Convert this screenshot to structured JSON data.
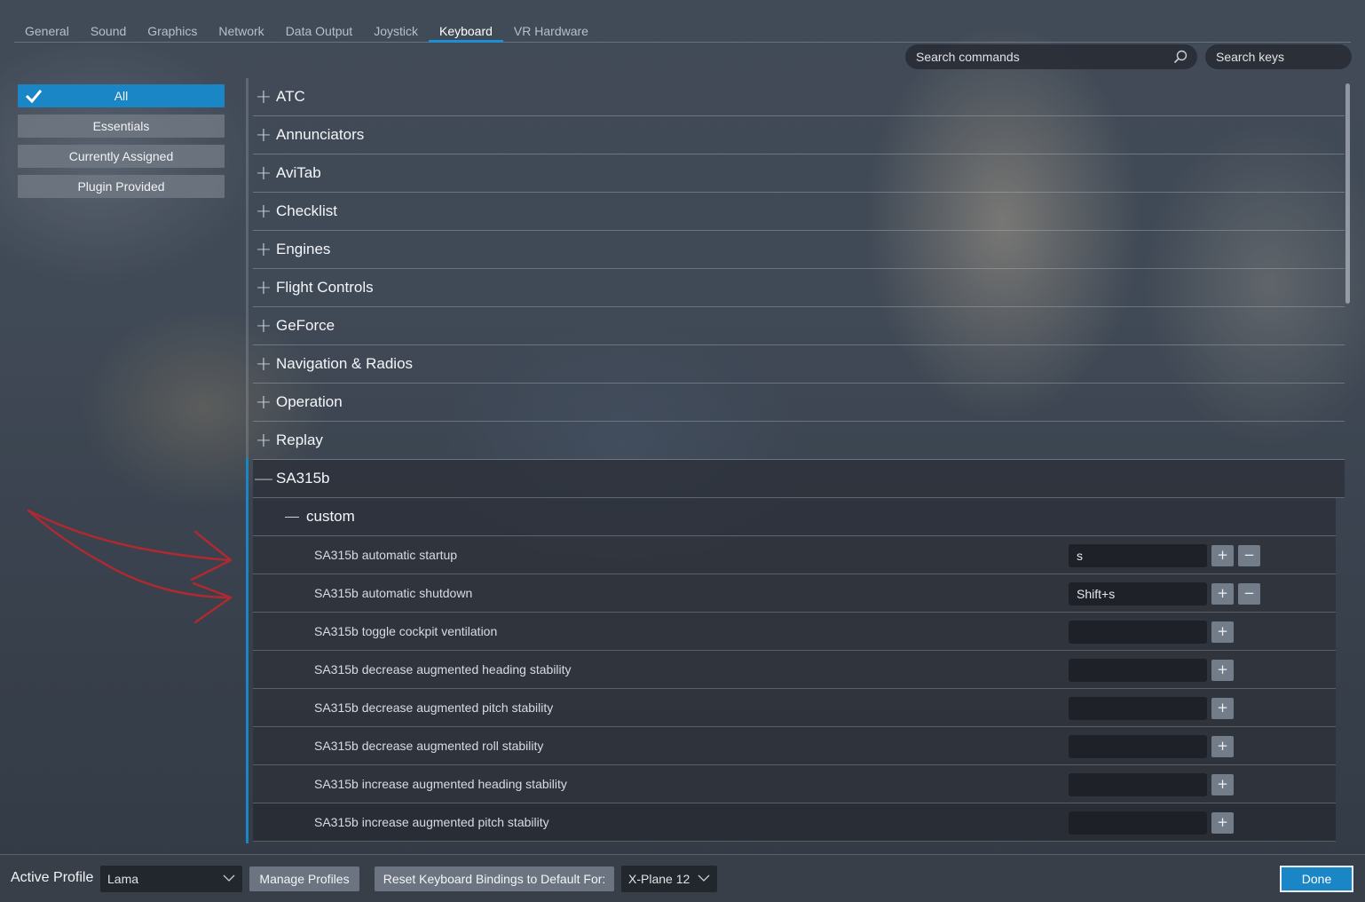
{
  "tabs": [
    {
      "label": "General"
    },
    {
      "label": "Sound"
    },
    {
      "label": "Graphics"
    },
    {
      "label": "Network"
    },
    {
      "label": "Data Output"
    },
    {
      "label": "Joystick"
    },
    {
      "label": "Keyboard",
      "active": true
    },
    {
      "label": "VR Hardware"
    }
  ],
  "search": {
    "commands_placeholder": "Search commands",
    "keys_placeholder": "Search keys"
  },
  "filters": [
    {
      "label": "All",
      "active": true
    },
    {
      "label": "Essentials"
    },
    {
      "label": "Currently Assigned"
    },
    {
      "label": "Plugin Provided"
    }
  ],
  "categories": [
    {
      "label": "ATC",
      "sign": "+"
    },
    {
      "label": "Annunciators",
      "sign": "+"
    },
    {
      "label": "AviTab",
      "sign": "+"
    },
    {
      "label": "Checklist",
      "sign": "+"
    },
    {
      "label": "Engines",
      "sign": "+"
    },
    {
      "label": "Flight Controls",
      "sign": "+"
    },
    {
      "label": "GeForce",
      "sign": "+"
    },
    {
      "label": "Navigation & Radios",
      "sign": "+"
    },
    {
      "label": "Operation",
      "sign": "+"
    },
    {
      "label": "Replay",
      "sign": "+"
    },
    {
      "label": "SA315b",
      "sign": "—"
    }
  ],
  "subcategory": {
    "label": "custom"
  },
  "commands": [
    {
      "label": "SA315b automatic startup",
      "key": "s"
    },
    {
      "label": "SA315b automatic shutdown",
      "key": "Shift+s"
    },
    {
      "label": "SA315b toggle cockpit ventilation",
      "key": ""
    },
    {
      "label": "SA315b decrease augmented heading stability",
      "key": ""
    },
    {
      "label": "SA315b decrease augmented pitch stability",
      "key": ""
    },
    {
      "label": "SA315b decrease augmented roll stability",
      "key": ""
    },
    {
      "label": "SA315b increase augmented heading stability",
      "key": ""
    },
    {
      "label": "SA315b increase augmented pitch stability",
      "key": ""
    }
  ],
  "buttons": {
    "add": "+",
    "remove": "−"
  },
  "bottom": {
    "active_profile_label": "Active Profile",
    "profile_value": "Lama",
    "manage_profiles": "Manage Profiles",
    "reset_label": "Reset Keyboard Bindings to Default For:",
    "reset_target": "X-Plane 12",
    "done": "Done"
  },
  "colors": {
    "accent": "#1b86c6",
    "annotation_arrow": "#c4252c"
  }
}
